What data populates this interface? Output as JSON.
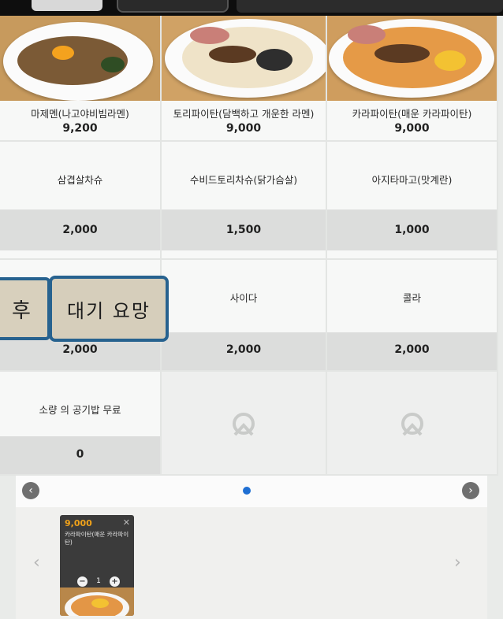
{
  "menu": {
    "items": [
      {
        "name": "마제멘(나고야비빔라멘)",
        "price": "9,200"
      },
      {
        "name": "토리파이탄(담백하고 개운한 라멘)",
        "price": "9,000"
      },
      {
        "name": "카라파이탄(매운 카라파이탄)",
        "price": "9,000"
      },
      {
        "name": "삼겹살차슈",
        "price": "2,000"
      },
      {
        "name": "수비드토리차슈(닭가슴살)",
        "price": "1,500"
      },
      {
        "name": "아지타마고(맛계란)",
        "price": "1,000"
      },
      {
        "name": "",
        "price": "2,000"
      },
      {
        "name": "사이다",
        "price": "2,000"
      },
      {
        "name": "콜라",
        "price": "2,000"
      },
      {
        "name": "소량 의 공기밥 무료",
        "price": "0"
      }
    ]
  },
  "sticker": {
    "left_text": "후",
    "main_text": "대기 요망"
  },
  "pager": {
    "prev": "‹",
    "next": "›"
  },
  "cart": {
    "prev": "‹",
    "next": "›",
    "items": [
      {
        "price": "9,000",
        "remove": "✕",
        "name": "카라파이탄(매운 카라파이탄)",
        "minus": "−",
        "qty": "1",
        "plus": "+"
      }
    ]
  },
  "colors": {
    "accent": "#1f6fd3",
    "price_orange": "#f0a21a",
    "sticker_border": "#27628f"
  }
}
